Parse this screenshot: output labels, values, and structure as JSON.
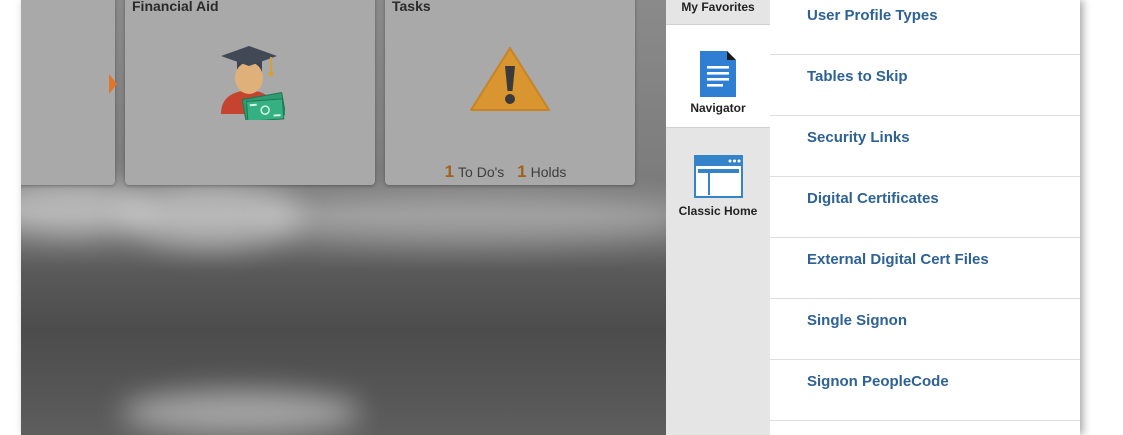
{
  "tiles": {
    "financial_aid": {
      "title": "Financial Aid"
    },
    "tasks": {
      "title": "Tasks",
      "todos_count": "1",
      "todos_label": "To Do's",
      "holds_count": "1",
      "holds_label": "Holds"
    }
  },
  "navbar": {
    "items": [
      {
        "label": "My Favorites"
      },
      {
        "label": "Navigator",
        "active": true
      },
      {
        "label": "Classic Home"
      }
    ]
  },
  "navigator_list": {
    "items": [
      {
        "label": "User Profile Types"
      },
      {
        "label": "Tables to Skip"
      },
      {
        "label": "Security Links"
      },
      {
        "label": "Digital Certificates"
      },
      {
        "label": "External Digital Cert Files"
      },
      {
        "label": "Single Signon"
      },
      {
        "label": "Signon PeopleCode"
      }
    ]
  },
  "colors": {
    "link": "#2e6295",
    "count_accent": "#a0611e",
    "warning": "#d9952f",
    "navigator_icon": "#2e7fd4"
  },
  "icons": [
    "graduate-cash-icon",
    "warning-triangle-icon",
    "document-icon",
    "browser-window-icon"
  ]
}
